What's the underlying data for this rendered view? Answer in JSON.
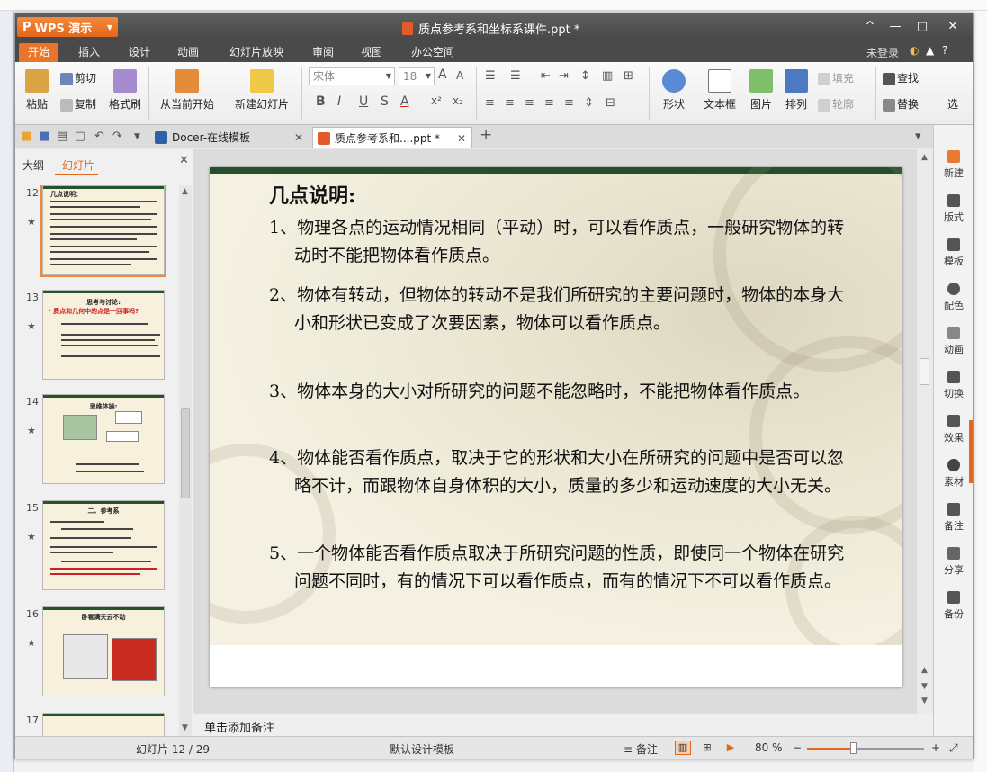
{
  "app": {
    "name": "WPS 演示",
    "logo": "P",
    "doc_title": "质点参考系和坐标系课件.ppt *",
    "login": "未登录",
    "help": "?"
  },
  "window_controls": {
    "collapse": "^",
    "minimize": "—",
    "maximize": "□",
    "close": "✕"
  },
  "ribbon_tabs": [
    "开始",
    "插入",
    "设计",
    "动画",
    "幻灯片放映",
    "审阅",
    "视图",
    "办公空间"
  ],
  "ribbon": {
    "paste": "粘贴",
    "cut": "剪切",
    "copy": "复制",
    "format_painter": "格式刷",
    "start_from_current": "从当前开始",
    "new_slide": "新建幻灯片",
    "font_name": "宋体",
    "font_size": "18",
    "shape": "形状",
    "textbox": "文本框",
    "picture": "图片",
    "arrange": "排列",
    "fill": "填充",
    "outline": "轮廓",
    "find": "查找",
    "replace": "替换",
    "select": "选"
  },
  "doc_tabs": [
    {
      "label": "Docer-在线模板"
    },
    {
      "label": "质点参考系和....ppt *"
    }
  ],
  "panel_tabs": {
    "outline": "大纲",
    "slides": "幻灯片"
  },
  "thumbnails": [
    {
      "num": "12",
      "title": "几点说明："
    },
    {
      "num": "13",
      "title": "思考与讨论:",
      "subtitle": "· 质点和几何中的点是一回事吗?"
    },
    {
      "num": "14",
      "title": "思维体操:"
    },
    {
      "num": "15",
      "title": "二、参考系"
    },
    {
      "num": "16",
      "title": "卧看满天云不动"
    },
    {
      "num": "17",
      "title": ""
    }
  ],
  "slide": {
    "title": "几点说明:",
    "points": [
      "1、物理各点的运动情况相同（平动）时，可以看作质点，一般研究物体的转动时不能把物体看作质点。",
      "2、物体有转动，但物体的转动不是我们所研究的主要问题时，物体的本身大小和形状已变成了次要因素，物体可以看作质点。",
      "3、物体本身的大小对所研究的问题不能忽略时，不能把物体看作质点。",
      "4、物体能否看作质点，取决于它的形状和大小在所研究的问题中是否可以忽略不计，而跟物体自身体积的大小，质量的多少和运动速度的大小无关。",
      "5、一个物体能否看作质点取决于所研究问题的性质，即使同一个物体在研究问题不同时，有的情况下可以看作质点，而有的情况下不可以看作质点。"
    ]
  },
  "notes_placeholder": "单击添加备注",
  "right_panel": [
    "新建",
    "版式",
    "模板",
    "配色",
    "动画",
    "切换",
    "效果",
    "素材",
    "备注",
    "分享",
    "备份"
  ],
  "status": {
    "slide_info": "幻灯片 12 / 29",
    "template": "默认设计模板",
    "notes": "备注",
    "zoom": "80 %",
    "zoom_level": 0.4
  },
  "colors": {
    "accent": "#e2681f",
    "titlebar": "#4a4a4a",
    "slide_bar": "#23502b"
  }
}
